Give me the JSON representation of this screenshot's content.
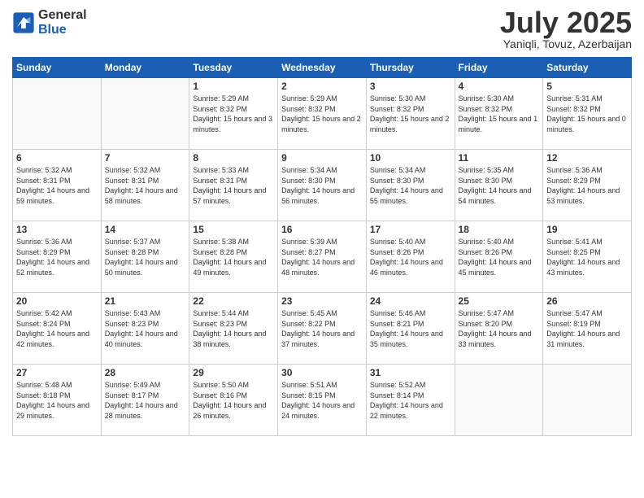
{
  "logo": {
    "general": "General",
    "blue": "Blue"
  },
  "title": "July 2025",
  "location": "Yaniqli, Tovuz, Azerbaijan",
  "days_of_week": [
    "Sunday",
    "Monday",
    "Tuesday",
    "Wednesday",
    "Thursday",
    "Friday",
    "Saturday"
  ],
  "weeks": [
    [
      {
        "day": "",
        "info": ""
      },
      {
        "day": "",
        "info": ""
      },
      {
        "day": "1",
        "info": "Sunrise: 5:29 AM\nSunset: 8:32 PM\nDaylight: 15 hours and 3 minutes."
      },
      {
        "day": "2",
        "info": "Sunrise: 5:29 AM\nSunset: 8:32 PM\nDaylight: 15 hours and 2 minutes."
      },
      {
        "day": "3",
        "info": "Sunrise: 5:30 AM\nSunset: 8:32 PM\nDaylight: 15 hours and 2 minutes."
      },
      {
        "day": "4",
        "info": "Sunrise: 5:30 AM\nSunset: 8:32 PM\nDaylight: 15 hours and 1 minute."
      },
      {
        "day": "5",
        "info": "Sunrise: 5:31 AM\nSunset: 8:32 PM\nDaylight: 15 hours and 0 minutes."
      }
    ],
    [
      {
        "day": "6",
        "info": "Sunrise: 5:32 AM\nSunset: 8:31 PM\nDaylight: 14 hours and 59 minutes."
      },
      {
        "day": "7",
        "info": "Sunrise: 5:32 AM\nSunset: 8:31 PM\nDaylight: 14 hours and 58 minutes."
      },
      {
        "day": "8",
        "info": "Sunrise: 5:33 AM\nSunset: 8:31 PM\nDaylight: 14 hours and 57 minutes."
      },
      {
        "day": "9",
        "info": "Sunrise: 5:34 AM\nSunset: 8:30 PM\nDaylight: 14 hours and 56 minutes."
      },
      {
        "day": "10",
        "info": "Sunrise: 5:34 AM\nSunset: 8:30 PM\nDaylight: 14 hours and 55 minutes."
      },
      {
        "day": "11",
        "info": "Sunrise: 5:35 AM\nSunset: 8:30 PM\nDaylight: 14 hours and 54 minutes."
      },
      {
        "day": "12",
        "info": "Sunrise: 5:36 AM\nSunset: 8:29 PM\nDaylight: 14 hours and 53 minutes."
      }
    ],
    [
      {
        "day": "13",
        "info": "Sunrise: 5:36 AM\nSunset: 8:29 PM\nDaylight: 14 hours and 52 minutes."
      },
      {
        "day": "14",
        "info": "Sunrise: 5:37 AM\nSunset: 8:28 PM\nDaylight: 14 hours and 50 minutes."
      },
      {
        "day": "15",
        "info": "Sunrise: 5:38 AM\nSunset: 8:28 PM\nDaylight: 14 hours and 49 minutes."
      },
      {
        "day": "16",
        "info": "Sunrise: 5:39 AM\nSunset: 8:27 PM\nDaylight: 14 hours and 48 minutes."
      },
      {
        "day": "17",
        "info": "Sunrise: 5:40 AM\nSunset: 8:26 PM\nDaylight: 14 hours and 46 minutes."
      },
      {
        "day": "18",
        "info": "Sunrise: 5:40 AM\nSunset: 8:26 PM\nDaylight: 14 hours and 45 minutes."
      },
      {
        "day": "19",
        "info": "Sunrise: 5:41 AM\nSunset: 8:25 PM\nDaylight: 14 hours and 43 minutes."
      }
    ],
    [
      {
        "day": "20",
        "info": "Sunrise: 5:42 AM\nSunset: 8:24 PM\nDaylight: 14 hours and 42 minutes."
      },
      {
        "day": "21",
        "info": "Sunrise: 5:43 AM\nSunset: 8:23 PM\nDaylight: 14 hours and 40 minutes."
      },
      {
        "day": "22",
        "info": "Sunrise: 5:44 AM\nSunset: 8:23 PM\nDaylight: 14 hours and 38 minutes."
      },
      {
        "day": "23",
        "info": "Sunrise: 5:45 AM\nSunset: 8:22 PM\nDaylight: 14 hours and 37 minutes."
      },
      {
        "day": "24",
        "info": "Sunrise: 5:46 AM\nSunset: 8:21 PM\nDaylight: 14 hours and 35 minutes."
      },
      {
        "day": "25",
        "info": "Sunrise: 5:47 AM\nSunset: 8:20 PM\nDaylight: 14 hours and 33 minutes."
      },
      {
        "day": "26",
        "info": "Sunrise: 5:47 AM\nSunset: 8:19 PM\nDaylight: 14 hours and 31 minutes."
      }
    ],
    [
      {
        "day": "27",
        "info": "Sunrise: 5:48 AM\nSunset: 8:18 PM\nDaylight: 14 hours and 29 minutes."
      },
      {
        "day": "28",
        "info": "Sunrise: 5:49 AM\nSunset: 8:17 PM\nDaylight: 14 hours and 28 minutes."
      },
      {
        "day": "29",
        "info": "Sunrise: 5:50 AM\nSunset: 8:16 PM\nDaylight: 14 hours and 26 minutes."
      },
      {
        "day": "30",
        "info": "Sunrise: 5:51 AM\nSunset: 8:15 PM\nDaylight: 14 hours and 24 minutes."
      },
      {
        "day": "31",
        "info": "Sunrise: 5:52 AM\nSunset: 8:14 PM\nDaylight: 14 hours and 22 minutes."
      },
      {
        "day": "",
        "info": ""
      },
      {
        "day": "",
        "info": ""
      }
    ]
  ]
}
